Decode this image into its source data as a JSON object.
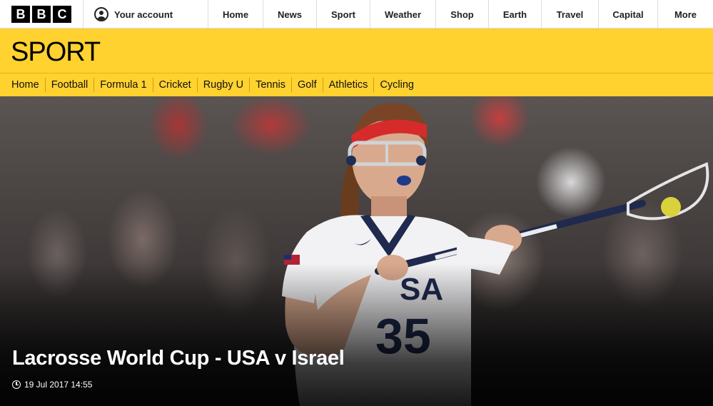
{
  "brand": {
    "letters": [
      "B",
      "B",
      "C"
    ]
  },
  "account": {
    "label": "Your account"
  },
  "nav": {
    "items": [
      {
        "label": "Home"
      },
      {
        "label": "News"
      },
      {
        "label": "Sport"
      },
      {
        "label": "Weather"
      },
      {
        "label": "Shop"
      },
      {
        "label": "Earth"
      },
      {
        "label": "Travel"
      },
      {
        "label": "Capital"
      },
      {
        "label": "More"
      }
    ]
  },
  "section": {
    "title": "SPORT"
  },
  "subnav": {
    "items": [
      {
        "label": "Home"
      },
      {
        "label": "Football"
      },
      {
        "label": "Formula 1"
      },
      {
        "label": "Cricket"
      },
      {
        "label": "Rugby U"
      },
      {
        "label": "Tennis"
      },
      {
        "label": "Golf"
      },
      {
        "label": "Athletics"
      },
      {
        "label": "Cycling"
      }
    ]
  },
  "article": {
    "headline": "Lacrosse World Cup - USA v Israel",
    "timestamp": "19 Jul 2017 14:55",
    "jersey_text": "USA",
    "jersey_number": "35"
  },
  "colors": {
    "sport_yellow": "#ffd230",
    "bbc_black": "#000000",
    "headband_red": "#d62b2b"
  },
  "icons": {
    "account": "user-icon",
    "time": "clock-icon"
  }
}
